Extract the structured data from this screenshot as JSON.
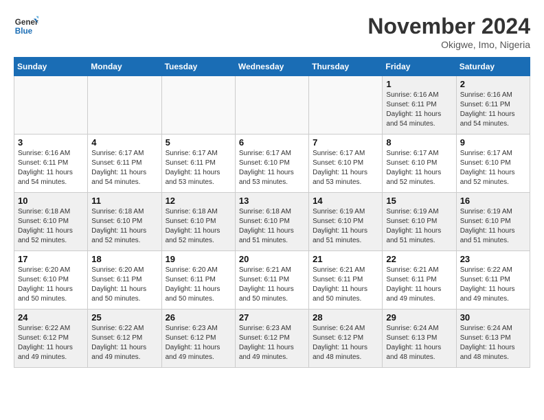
{
  "logo": {
    "line1": "General",
    "line2": "Blue"
  },
  "title": "November 2024",
  "location": "Okigwe, Imo, Nigeria",
  "weekdays": [
    "Sunday",
    "Monday",
    "Tuesday",
    "Wednesday",
    "Thursday",
    "Friday",
    "Saturday"
  ],
  "weeks": [
    [
      {
        "day": "",
        "info": "",
        "empty": true
      },
      {
        "day": "",
        "info": "",
        "empty": true
      },
      {
        "day": "",
        "info": "",
        "empty": true
      },
      {
        "day": "",
        "info": "",
        "empty": true
      },
      {
        "day": "",
        "info": "",
        "empty": true
      },
      {
        "day": "1",
        "info": "Sunrise: 6:16 AM\nSunset: 6:11 PM\nDaylight: 11 hours\nand 54 minutes."
      },
      {
        "day": "2",
        "info": "Sunrise: 6:16 AM\nSunset: 6:11 PM\nDaylight: 11 hours\nand 54 minutes."
      }
    ],
    [
      {
        "day": "3",
        "info": "Sunrise: 6:16 AM\nSunset: 6:11 PM\nDaylight: 11 hours\nand 54 minutes."
      },
      {
        "day": "4",
        "info": "Sunrise: 6:17 AM\nSunset: 6:11 PM\nDaylight: 11 hours\nand 54 minutes."
      },
      {
        "day": "5",
        "info": "Sunrise: 6:17 AM\nSunset: 6:11 PM\nDaylight: 11 hours\nand 53 minutes."
      },
      {
        "day": "6",
        "info": "Sunrise: 6:17 AM\nSunset: 6:10 PM\nDaylight: 11 hours\nand 53 minutes."
      },
      {
        "day": "7",
        "info": "Sunrise: 6:17 AM\nSunset: 6:10 PM\nDaylight: 11 hours\nand 53 minutes."
      },
      {
        "day": "8",
        "info": "Sunrise: 6:17 AM\nSunset: 6:10 PM\nDaylight: 11 hours\nand 52 minutes."
      },
      {
        "day": "9",
        "info": "Sunrise: 6:17 AM\nSunset: 6:10 PM\nDaylight: 11 hours\nand 52 minutes."
      }
    ],
    [
      {
        "day": "10",
        "info": "Sunrise: 6:18 AM\nSunset: 6:10 PM\nDaylight: 11 hours\nand 52 minutes."
      },
      {
        "day": "11",
        "info": "Sunrise: 6:18 AM\nSunset: 6:10 PM\nDaylight: 11 hours\nand 52 minutes."
      },
      {
        "day": "12",
        "info": "Sunrise: 6:18 AM\nSunset: 6:10 PM\nDaylight: 11 hours\nand 52 minutes."
      },
      {
        "day": "13",
        "info": "Sunrise: 6:18 AM\nSunset: 6:10 PM\nDaylight: 11 hours\nand 51 minutes."
      },
      {
        "day": "14",
        "info": "Sunrise: 6:19 AM\nSunset: 6:10 PM\nDaylight: 11 hours\nand 51 minutes."
      },
      {
        "day": "15",
        "info": "Sunrise: 6:19 AM\nSunset: 6:10 PM\nDaylight: 11 hours\nand 51 minutes."
      },
      {
        "day": "16",
        "info": "Sunrise: 6:19 AM\nSunset: 6:10 PM\nDaylight: 11 hours\nand 51 minutes."
      }
    ],
    [
      {
        "day": "17",
        "info": "Sunrise: 6:20 AM\nSunset: 6:10 PM\nDaylight: 11 hours\nand 50 minutes."
      },
      {
        "day": "18",
        "info": "Sunrise: 6:20 AM\nSunset: 6:11 PM\nDaylight: 11 hours\nand 50 minutes."
      },
      {
        "day": "19",
        "info": "Sunrise: 6:20 AM\nSunset: 6:11 PM\nDaylight: 11 hours\nand 50 minutes."
      },
      {
        "day": "20",
        "info": "Sunrise: 6:21 AM\nSunset: 6:11 PM\nDaylight: 11 hours\nand 50 minutes."
      },
      {
        "day": "21",
        "info": "Sunrise: 6:21 AM\nSunset: 6:11 PM\nDaylight: 11 hours\nand 50 minutes."
      },
      {
        "day": "22",
        "info": "Sunrise: 6:21 AM\nSunset: 6:11 PM\nDaylight: 11 hours\nand 49 minutes."
      },
      {
        "day": "23",
        "info": "Sunrise: 6:22 AM\nSunset: 6:11 PM\nDaylight: 11 hours\nand 49 minutes."
      }
    ],
    [
      {
        "day": "24",
        "info": "Sunrise: 6:22 AM\nSunset: 6:12 PM\nDaylight: 11 hours\nand 49 minutes."
      },
      {
        "day": "25",
        "info": "Sunrise: 6:22 AM\nSunset: 6:12 PM\nDaylight: 11 hours\nand 49 minutes."
      },
      {
        "day": "26",
        "info": "Sunrise: 6:23 AM\nSunset: 6:12 PM\nDaylight: 11 hours\nand 49 minutes."
      },
      {
        "day": "27",
        "info": "Sunrise: 6:23 AM\nSunset: 6:12 PM\nDaylight: 11 hours\nand 49 minutes."
      },
      {
        "day": "28",
        "info": "Sunrise: 6:24 AM\nSunset: 6:12 PM\nDaylight: 11 hours\nand 48 minutes."
      },
      {
        "day": "29",
        "info": "Sunrise: 6:24 AM\nSunset: 6:13 PM\nDaylight: 11 hours\nand 48 minutes."
      },
      {
        "day": "30",
        "info": "Sunrise: 6:24 AM\nSunset: 6:13 PM\nDaylight: 11 hours\nand 48 minutes."
      }
    ]
  ]
}
